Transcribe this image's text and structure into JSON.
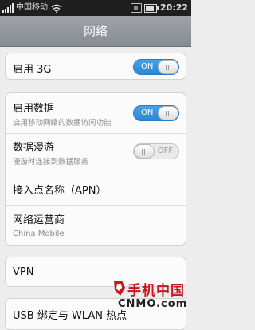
{
  "status_bar": {
    "carrier": "中国移动",
    "time": "20:22"
  },
  "header": {
    "title": "网络"
  },
  "settings": {
    "enable_3g": {
      "label": "启用 3G",
      "toggle": "ON",
      "state": true
    },
    "enable_data": {
      "label": "启用数据",
      "description": "启用移动网络的数据访问功能",
      "toggle": "ON",
      "state": true
    },
    "data_roaming": {
      "label": "数据漫游",
      "description": "漫游时连接到数据服务",
      "toggle": "OFF",
      "state": false
    },
    "apn": {
      "label": "接入点名称（APN）"
    },
    "operator": {
      "label": "网络运营商",
      "value": "China Mobile"
    },
    "vpn": {
      "label": "VPN"
    },
    "tethering": {
      "label": "USB 绑定与 WLAN 热点"
    }
  },
  "watermark": {
    "brand": "手机中国",
    "domain": "CNMO.com"
  },
  "colors": {
    "toggle_on": "#2d86d3",
    "title_bar": "#8f9399",
    "watermark_red": "#c8161d"
  }
}
